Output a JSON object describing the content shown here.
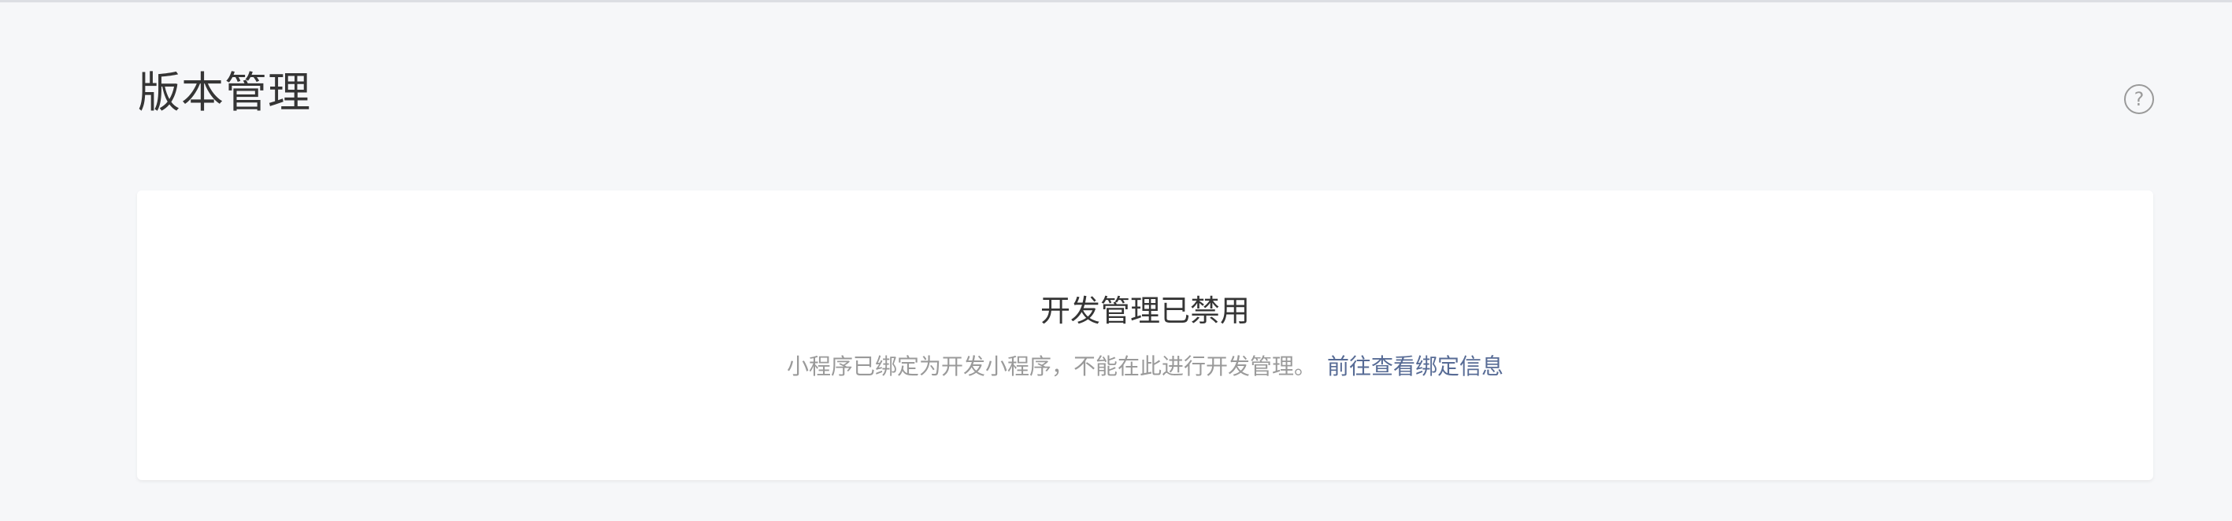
{
  "page": {
    "title": "版本管理",
    "help_icon": "question-circle-icon"
  },
  "notice": {
    "title": "开发管理已禁用",
    "description": "小程序已绑定为开发小程序，不能在此进行开发管理。",
    "link_label": "前往查看绑定信息"
  },
  "colors": {
    "background": "#f6f7f9",
    "card": "#ffffff",
    "text": "#353535",
    "muted": "#9a9a9a",
    "link": "#576b95"
  }
}
